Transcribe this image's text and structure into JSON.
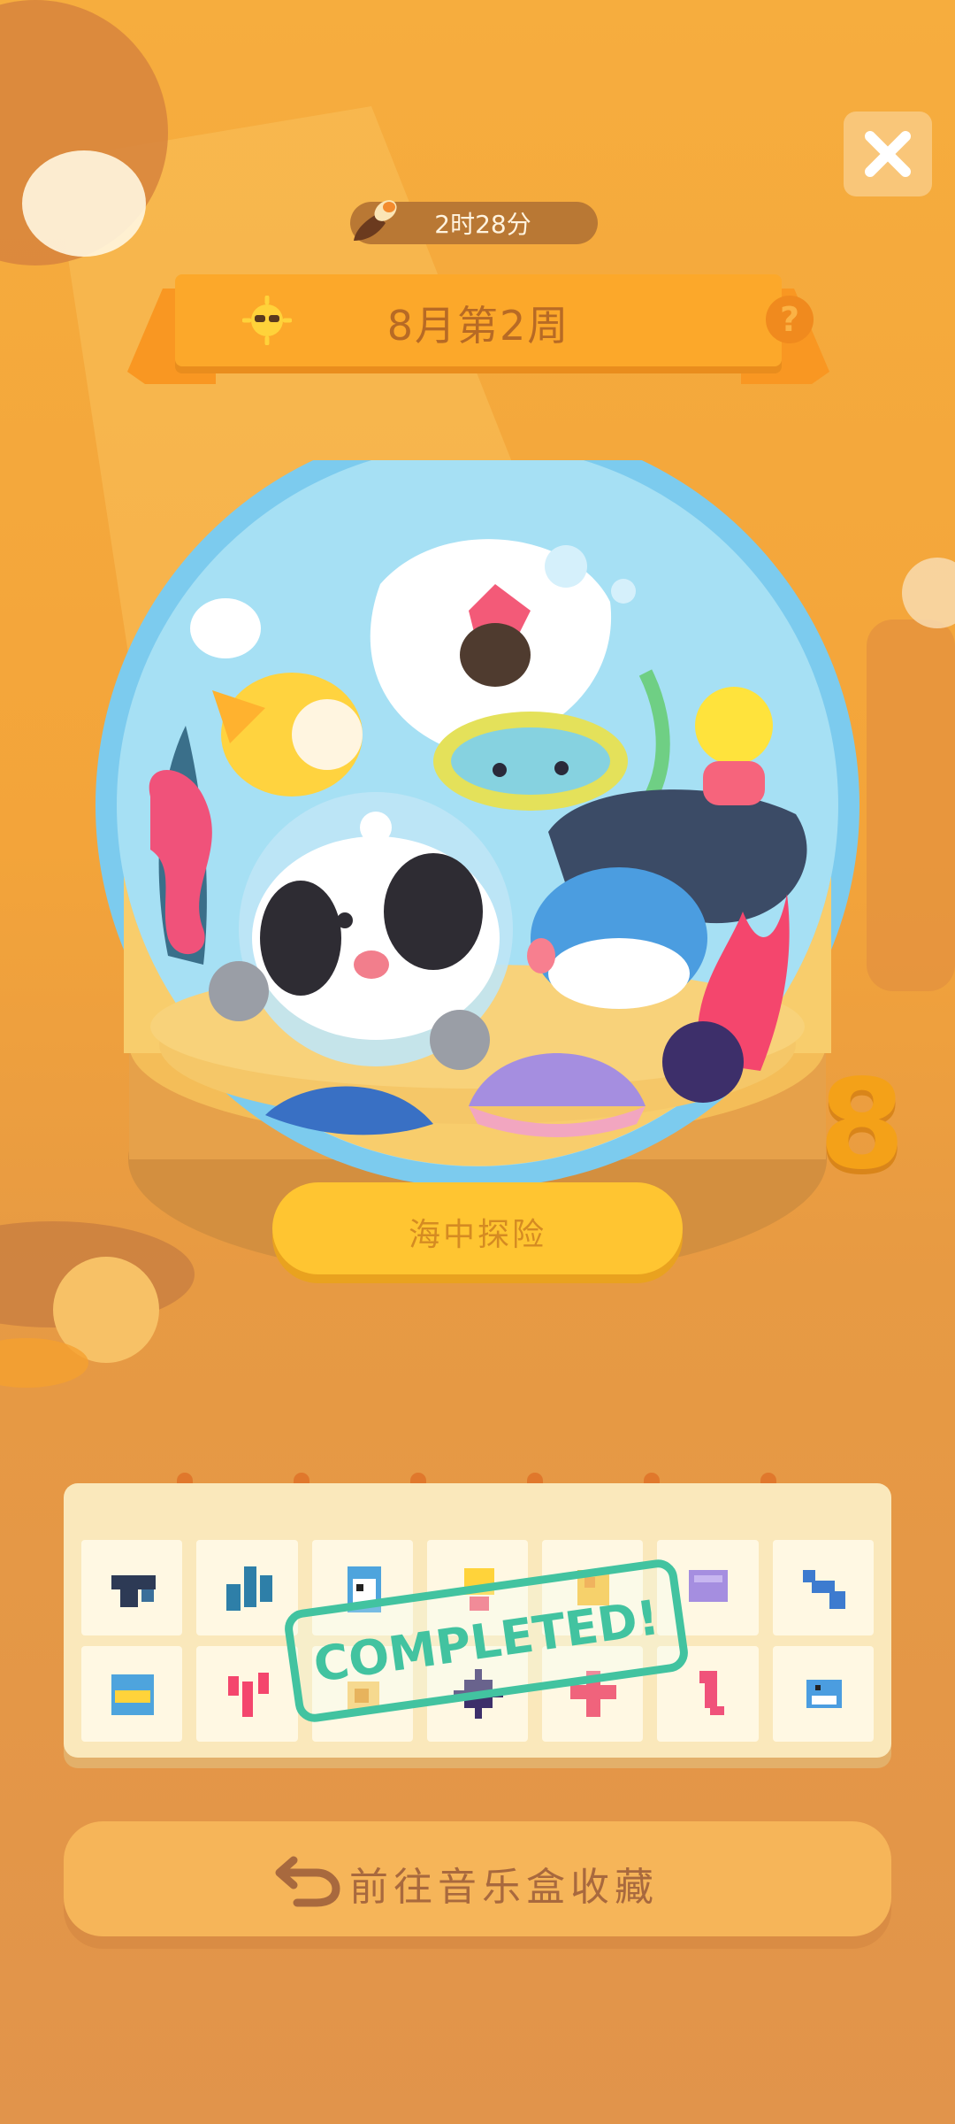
{
  "header": {
    "timer": "2时28分",
    "week_title": "8月第2周"
  },
  "globe": {
    "name": "海中探险",
    "number": "8"
  },
  "collection": {
    "stamp_text": "COMPLETED!",
    "row1": [
      "fish-shadow-icon",
      "coral-blue-icon",
      "penguin-icon",
      "flower-yellow-icon",
      "shell-yellow-icon",
      "clam-purple-icon",
      "whale-blue-icon"
    ],
    "row2": [
      "mask-cat-icon",
      "coral-pink-icon",
      "snail-icon",
      "urchin-icon",
      "starfish-icon",
      "seahorse-icon",
      "pufferfish-icon"
    ]
  },
  "footer": {
    "goto_label": "前往音乐盒收藏"
  },
  "colors": {
    "background": "#f6ad3e",
    "banner": "#fca82a",
    "stamp": "#42c3a0",
    "panel": "#fae8bb"
  }
}
